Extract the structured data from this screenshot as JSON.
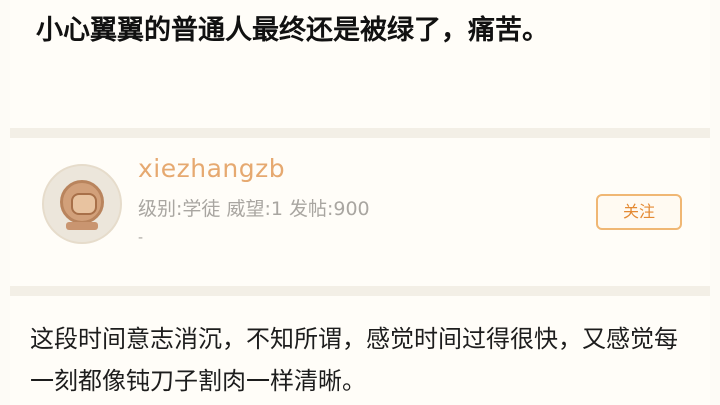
{
  "post": {
    "title": "小心翼翼的普通人最终还是被绿了，痛苦。",
    "content": "这段时间意志消沉，不知所谓，感觉时间过得很快，又感觉每一刻都像钝刀子割肉一样清晰。"
  },
  "author": {
    "username": "xiezhangzb",
    "meta": "级别:学徒 威望:1 发帖:900",
    "meta_extra": "-",
    "follow_label": "关注"
  },
  "colors": {
    "accent": "#e6a970",
    "follow_border": "#f0b774",
    "background": "#fdfbf6"
  }
}
